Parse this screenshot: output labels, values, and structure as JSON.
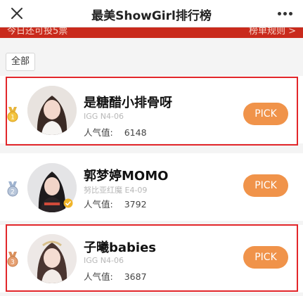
{
  "header": {
    "title": "最美ShowGirl排行榜",
    "close_icon": "close-icon",
    "more_icon": "more-dots-icon"
  },
  "subbar": {
    "left_text": "今日还可投5票",
    "right_text": "榜单规则 >"
  },
  "filter": {
    "all_label": "全部"
  },
  "colors": {
    "accent_red": "#c92a1c",
    "highlight_border": "#e2262a",
    "pick_button": "#f0934a"
  },
  "ranking": [
    {
      "rank": "1",
      "name": "是糖醋小排骨呀",
      "booth": "IGG N4-06",
      "popularity_label": "人气值:",
      "popularity_value": "6148",
      "pick_label": "PICK"
    },
    {
      "rank": "2",
      "name": "郭梦婷MOMO",
      "booth": "努比亚红魔 E4-09",
      "popularity_label": "人气值:",
      "popularity_value": "3792",
      "pick_label": "PICK"
    },
    {
      "rank": "3",
      "name": "子曦babies",
      "booth": "IGG N4-06",
      "popularity_label": "人气值:",
      "popularity_value": "3687",
      "pick_label": "PICK"
    }
  ]
}
